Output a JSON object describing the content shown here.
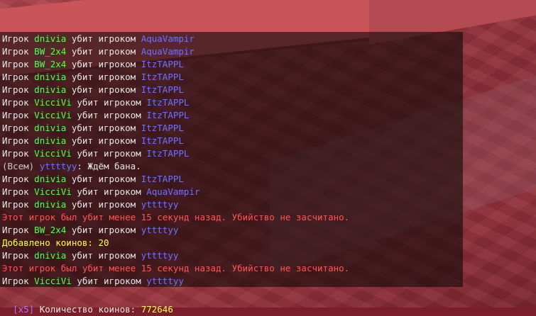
{
  "chat": {
    "lines": [
      {
        "type": "kill",
        "prefix": "Игрок",
        "killer": "dnivia",
        "middle": "убит игроком",
        "victim": "AquaVampir"
      },
      {
        "type": "kill",
        "prefix": "Игрок",
        "killer": "BW_2x4",
        "middle": "убит игроком",
        "victim": "AquaVampir"
      },
      {
        "type": "kill",
        "prefix": "Игрок",
        "killer": "BW_2x4",
        "middle": "убит игроком",
        "victim": "ItzTAPPL"
      },
      {
        "type": "kill",
        "prefix": "Игрок",
        "killer": "dnivia",
        "middle": "убит игроком",
        "victim": "ItzTAPPL"
      },
      {
        "type": "kill",
        "prefix": "Игрок",
        "killer": "dnivia",
        "middle": "убит игроком",
        "victim": "ItzTAPPL"
      },
      {
        "type": "kill",
        "prefix": "Игрок",
        "killer": "VicciVi",
        "middle": "убит игроком",
        "victim": "ItzTAPPL"
      },
      {
        "type": "kill",
        "prefix": "Игрок",
        "killer": "VicciVi",
        "middle": "убит игроком",
        "victim": "ItzTAPPL"
      },
      {
        "type": "kill",
        "prefix": "Игрок",
        "killer": "dnivia",
        "middle": "убит игроком",
        "victim": "ItzTAPPL"
      },
      {
        "type": "kill",
        "prefix": "Игрок",
        "killer": "dnivia",
        "middle": "убит игроком",
        "victim": "ItzTAPPL"
      },
      {
        "type": "kill",
        "prefix": "Игрок",
        "killer": "VicciVi",
        "middle": "убит игроком",
        "victim": "ItzTAPPL"
      },
      {
        "type": "msg",
        "channel": "(Всем)",
        "author": "yttttyy",
        "text": ": Ждём бана."
      },
      {
        "type": "kill",
        "prefix": "Игрок",
        "killer": "dnivia",
        "middle": "убит игроком",
        "victim": "ItzTAPPL"
      },
      {
        "type": "kill",
        "prefix": "Игрок",
        "killer": "VicciVi",
        "middle": "убит игроком",
        "victim": "AquaVampir"
      },
      {
        "type": "kill",
        "prefix": "Игрок",
        "killer": "dnivia",
        "middle": "убит игроком",
        "victim": "yttttyy"
      },
      {
        "type": "warn",
        "text": "Этот игрок был убит менее 15 секунд назад. Убийство не засчитано."
      },
      {
        "type": "kill",
        "prefix": "Игрок",
        "killer": "BW_2x4",
        "middle": "убит игроком",
        "victim": "yttttyy"
      },
      {
        "type": "coins",
        "text": "Добавлено коинов: 20"
      },
      {
        "type": "kill",
        "prefix": "Игрок",
        "killer": "dnivia",
        "middle": "убит игроком",
        "victim": "yttttyy"
      },
      {
        "type": "warn",
        "text": "Этот игрок был убит менее 15 секунд назад. Убийство не засчитано."
      },
      {
        "type": "kill",
        "prefix": "Игрок",
        "killer": "VicciVi",
        "middle": "убит игроком",
        "victim": "yttttyy"
      }
    ]
  },
  "status": {
    "multiplier": "[x5]",
    "label": " Количество коинов: ",
    "value": "772646"
  },
  "colors": {
    "killer": "#55ff55",
    "victim": "#6b74ff",
    "warn": "#ff5555",
    "coins": "#ffff55",
    "text": "#e6e6e6",
    "multiplier": "#b070ff"
  }
}
